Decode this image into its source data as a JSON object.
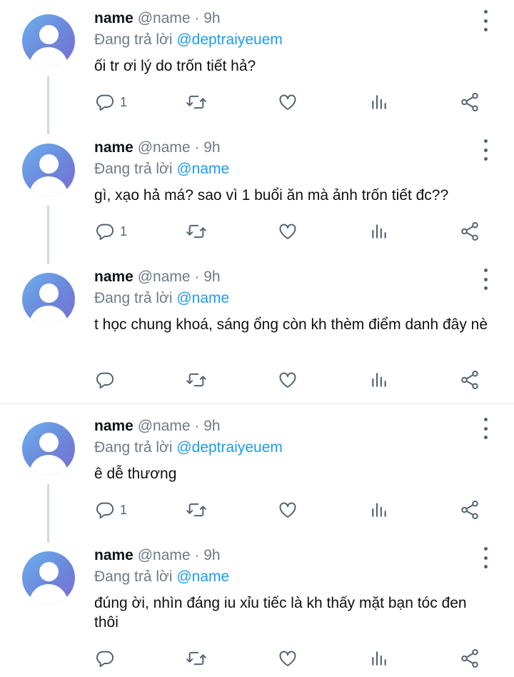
{
  "tweets": [
    {
      "name": "name",
      "handle": "@name",
      "dot": "·",
      "time": "9h",
      "reply_prefix": "Đang trả lời",
      "reply_to": "@deptraiyeuem",
      "text": "ối tr ơi lý do trốn tiết hả?",
      "reply_count": "1"
    },
    {
      "name": "name",
      "handle": "@name",
      "dot": "·",
      "time": "9h",
      "reply_prefix": "Đang trả lời",
      "reply_to": "@name",
      "text": "gì, xạo hả má? sao vì 1 buổi ăn mà ảnh trốn tiết đc??",
      "reply_count": "1"
    },
    {
      "name": "name",
      "handle": "@name",
      "dot": "·",
      "time": "9h",
      "reply_prefix": "Đang trả lời",
      "reply_to": "@name",
      "text": "t học chung khoá, sáng ổng còn kh thèm điểm danh đây nè",
      "reply_count": ""
    },
    {
      "name": "name",
      "handle": "@name",
      "dot": "·",
      "time": "9h",
      "reply_prefix": "Đang trả lời",
      "reply_to": "@deptraiyeuem",
      "text": "ê dễ thương",
      "reply_count": "1"
    },
    {
      "name": "name",
      "handle": "@name",
      "dot": "·",
      "time": "9h",
      "reply_prefix": "Đang trả lời",
      "reply_to": "@name",
      "text": "đúng ời, nhìn đáng iu xỉu tiếc là kh thấy mặt bạn tóc đen thôi",
      "reply_count": ""
    }
  ],
  "icons": {
    "reply": "reply-icon",
    "retweet": "retweet-icon",
    "like": "heart-icon",
    "views": "analytics-icon",
    "share": "share-icon",
    "more": "more-options-icon"
  },
  "colors": {
    "mention": "#1d9bf0",
    "secondary_text": "#6e7b87",
    "icon": "#536471",
    "thread_line": "#cfd9de"
  }
}
